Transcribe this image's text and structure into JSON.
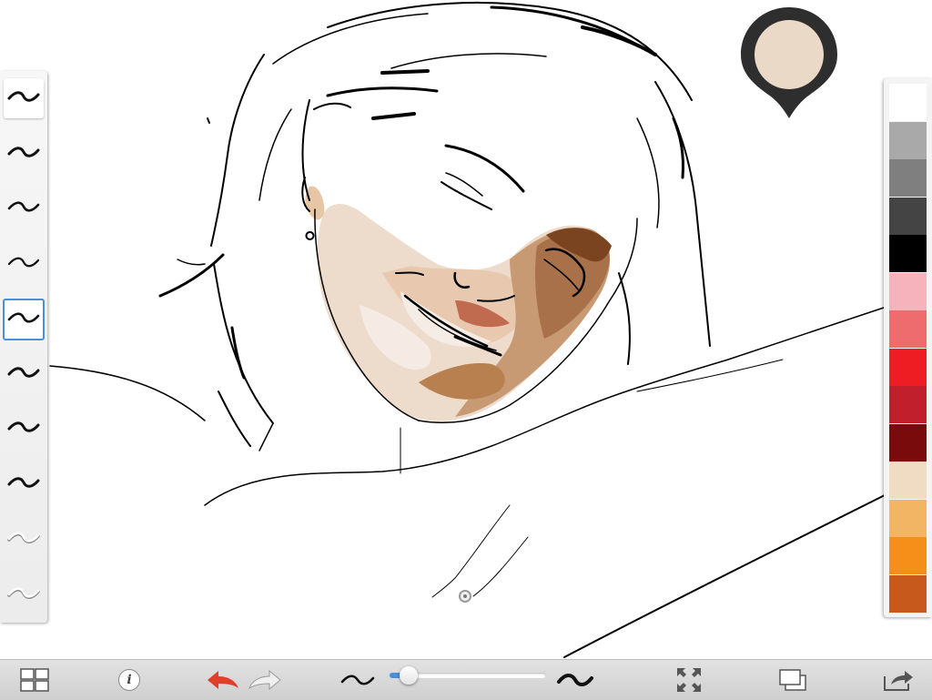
{
  "app": {
    "accent_color": "#4a90d9",
    "current_color": "#ead9c6"
  },
  "brush_panel": {
    "brushes": [
      {
        "icon": "tilde-stroke-icon",
        "state": "top"
      },
      {
        "icon": "tilde-stroke-icon",
        "state": "normal"
      },
      {
        "icon": "tilde-stroke-icon",
        "state": "normal"
      },
      {
        "icon": "tilde-stroke-icon",
        "state": "normal"
      },
      {
        "icon": "tilde-stroke-icon",
        "state": "selected"
      },
      {
        "icon": "tilde-stroke-icon",
        "state": "normal"
      },
      {
        "icon": "tilde-stroke-icon",
        "state": "normal"
      },
      {
        "icon": "tilde-stroke-icon",
        "state": "normal"
      },
      {
        "icon": "tilde-stroke-icon",
        "state": "light"
      },
      {
        "icon": "tilde-stroke-icon",
        "state": "light"
      }
    ]
  },
  "palette": {
    "swatches": [
      "#ffffff",
      "#a9a9a9",
      "#7f7f7f",
      "#444444",
      "#000000",
      "#f7b3bc",
      "#ee6b6e",
      "#ee1d23",
      "#c21f2d",
      "#7a0b0c",
      "#efdcc3",
      "#f2b563",
      "#f58f1a",
      "#c8591c"
    ]
  },
  "toolbar": {
    "gallery_icon": "grid-icon",
    "info_icon": "info-icon",
    "info_label": "i",
    "undo_icon": "undo-arrow-icon",
    "undo_color": "#e0402b",
    "redo_icon": "redo-arrow-icon",
    "brush_size_min_icon": "thin-stroke-icon",
    "brush_size_max_icon": "thick-stroke-icon",
    "brush_size": 0.12,
    "fullscreen_icon": "expand-icon",
    "layers_icon": "layers-icon",
    "share_icon": "share-icon"
  }
}
